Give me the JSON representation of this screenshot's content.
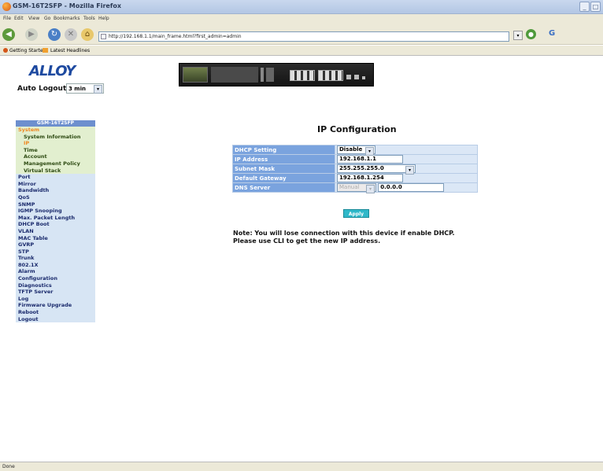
{
  "browser": {
    "title": "GSM-16T2SFP - Mozilla Firefox",
    "menus": [
      "File",
      "Edit",
      "View",
      "Go",
      "Bookmarks",
      "Tools",
      "Help"
    ],
    "url": "http://192.168.1.1/main_frame.html?first_admin=admin",
    "bookmarks": [
      "Getting Started",
      "Latest Headlines"
    ],
    "status": "Done"
  },
  "header": {
    "logo": "ALLOY",
    "auto_logout_label": "Auto Logout",
    "auto_logout_value": "3 min"
  },
  "sidebar": {
    "header": "GSM-16T2SFP",
    "items": [
      {
        "label": "System",
        "level": 0
      },
      {
        "label": "System Information",
        "level": 1
      },
      {
        "label": "IP",
        "level": 1
      },
      {
        "label": "Time",
        "level": 1
      },
      {
        "label": "Account",
        "level": 1
      },
      {
        "label": "Management Policy",
        "level": 1
      },
      {
        "label": "Virtual Stack",
        "level": 1
      },
      {
        "label": "Port",
        "level": 0
      },
      {
        "label": "Mirror",
        "level": 0
      },
      {
        "label": "Bandwidth",
        "level": 0
      },
      {
        "label": "QoS",
        "level": 0
      },
      {
        "label": "SNMP",
        "level": 0
      },
      {
        "label": "IGMP Snooping",
        "level": 0
      },
      {
        "label": "Max. Packet Length",
        "level": 0
      },
      {
        "label": "DHCP Boot",
        "level": 0
      },
      {
        "label": "VLAN",
        "level": 0
      },
      {
        "label": "MAC Table",
        "level": 0
      },
      {
        "label": "GVRP",
        "level": 0
      },
      {
        "label": "STP",
        "level": 0
      },
      {
        "label": "Trunk",
        "level": 0
      },
      {
        "label": "802.1X",
        "level": 0
      },
      {
        "label": "Alarm",
        "level": 0
      },
      {
        "label": "Configuration",
        "level": 0
      },
      {
        "label": "Diagnostics",
        "level": 0
      },
      {
        "label": "TFTP Server",
        "level": 0
      },
      {
        "label": "Log",
        "level": 0
      },
      {
        "label": "Firmware Upgrade",
        "level": 0
      },
      {
        "label": "Reboot",
        "level": 0
      },
      {
        "label": "Logout",
        "level": 0
      }
    ]
  },
  "main": {
    "title": "IP Configuration",
    "fields": {
      "dhcp_label": "DHCP Setting",
      "dhcp_value": "Disable",
      "ip_label": "IP Address",
      "ip_value": "192.168.1.1",
      "mask_label": "Subnet Mask",
      "mask_value": "255.255.255.0",
      "gateway_label": "Default Gateway",
      "gateway_value": "192.168.1.254",
      "dns_label": "DNS Server",
      "dns_mode": "Manual",
      "dns_value": "0.0.0.0"
    },
    "apply_label": "Apply",
    "note_line1": "Note: You will lose connection with this device if enable DHCP.",
    "note_line2": "Please use CLI to get the new IP address."
  }
}
